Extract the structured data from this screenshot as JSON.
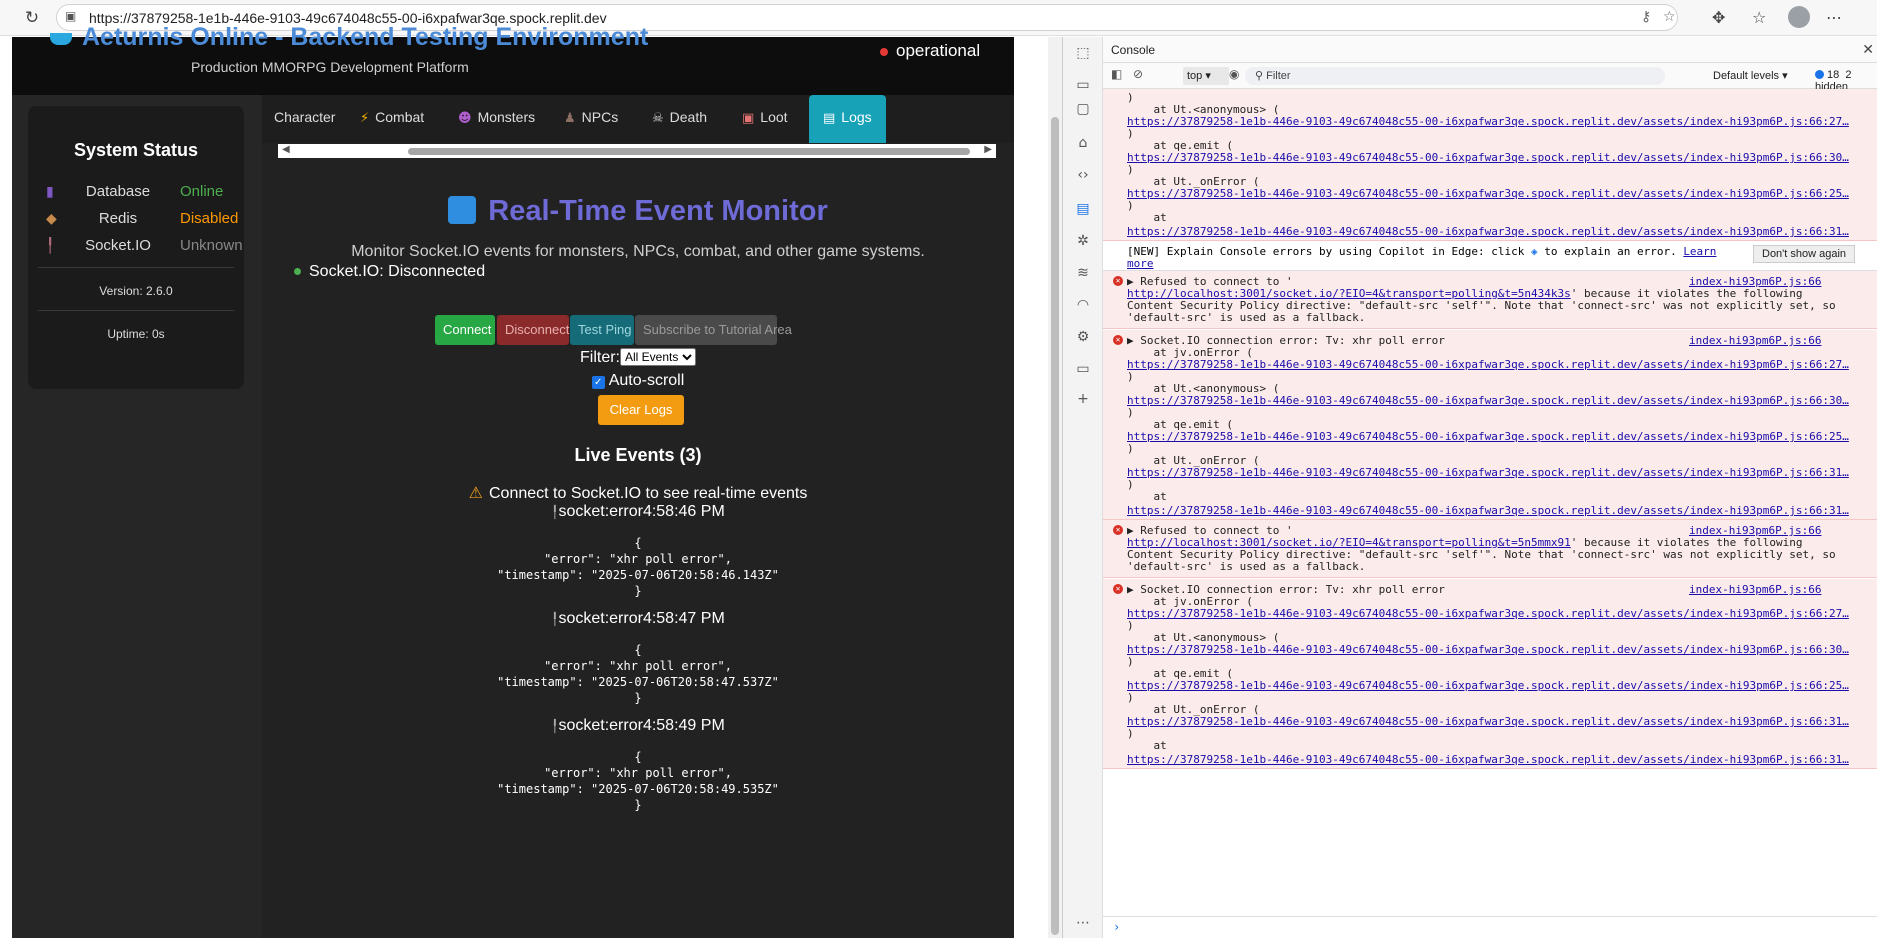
{
  "browser": {
    "url": "https://37879258-1e1b-446e-9103-49c674048c55-00-i6xpafwar3qe.spock.replit.dev"
  },
  "app": {
    "title": "Aeturnis Online - Backend Testing Environment",
    "subtitle": "Production MMORPG Development Platform",
    "status": "operational"
  },
  "system_status": {
    "heading": "System Status",
    "rows": [
      {
        "name": "Database",
        "value": "Online",
        "color": "#4caf50"
      },
      {
        "name": "Redis",
        "value": "Disabled",
        "color": "#ff9800"
      },
      {
        "name": "Socket.IO",
        "value": "Unknown",
        "color": "#888888"
      }
    ],
    "version": "Version: 2.6.0",
    "uptime": "Uptime: 0s"
  },
  "tabs": [
    "Character",
    "Combat",
    "Monsters",
    "NPCs",
    "Death",
    "Loot",
    "Logs"
  ],
  "monitor": {
    "title": "Real-Time Event Monitor",
    "description": "Monitor Socket.IO events for monsters, NPCs, combat, and other game systems.",
    "connection": "Socket.IO: Disconnected",
    "buttons": {
      "connect": "Connect",
      "disconnect": "Disconnect",
      "ping": "Test Ping",
      "subscribe": "Subscribe to Tutorial Area",
      "clear": "Clear Logs"
    },
    "filter_label": "Filter:",
    "filter_value": "All Events",
    "autoscroll": "Auto-scroll",
    "live_heading": "Live Events (3)",
    "warning": "Connect to Socket.IO to see real-time events",
    "events": [
      {
        "type": "socket:error",
        "time": "4:58:46 PM",
        "lines": [
          "{",
          "\"error\": \"xhr poll error\",",
          "\"timestamp\": \"2025-07-06T20:58:46.143Z\"",
          "}"
        ]
      },
      {
        "type": "socket:error",
        "time": "4:58:47 PM",
        "lines": [
          "{",
          "\"error\": \"xhr poll error\",",
          "\"timestamp\": \"2025-07-06T20:58:47.537Z\"",
          "}"
        ]
      },
      {
        "type": "socket:error",
        "time": "4:58:49 PM",
        "lines": [
          "{",
          "\"error\": \"xhr poll error\",",
          "\"timestamp\": \"2025-07-06T20:58:49.535Z\"",
          "}"
        ]
      }
    ]
  },
  "devtools": {
    "panel": "Console",
    "context": "top",
    "filter_placeholder": "Filter",
    "levels": "Default levels",
    "issues": "18",
    "hidden": "2 hidden",
    "stack_top": [
      ")",
      "    at Ut.<anonymous> (",
      "https://37879258-1e1b-446e-9103-49c674048c55-00-i6xpafwar3qe.spock.replit.dev/assets/index-hi93pm6P.js:66:27…",
      ")",
      "    at qe.emit (",
      "https://37879258-1e1b-446e-9103-49c674048c55-00-i6xpafwar3qe.spock.replit.dev/assets/index-hi93pm6P.js:66:30…",
      ")",
      "    at Ut._onError (",
      "https://37879258-1e1b-446e-9103-49c674048c55-00-i6xpafwar3qe.spock.replit.dev/assets/index-hi93pm6P.js:66:25…",
      ")",
      "    at",
      "https://37879258-1e1b-446e-9103-49c674048c55-00-i6xpafwar3qe.spock.replit.dev/assets/index-hi93pm6P.js:66:31…"
    ],
    "tip": "[NEW] Explain Console errors by using Copilot in Edge: click",
    "tip_tail": "to explain an error.",
    "tip_learn": "Learn",
    "tip_more": "more",
    "dont_show": "Don't show again",
    "refused1": {
      "src": "index-hi93pm6P.js:66",
      "l1": "▶ Refused to connect to '",
      "l2": "http://localhost:3001/socket.io/?EIO=4&transport=polling&t=5n434k3s",
      "l2b": "' because it violates the following",
      "l3": "Content Security Policy directive: \"default-src 'self'\". Note that 'connect-src' was not explicitly set, so",
      "l4": "'default-src' is used as a fallback."
    },
    "sioerr1": {
      "src": "index-hi93pm6P.js:66",
      "head": "▶ Socket.IO connection error: Tv: xhr poll error",
      "lines": [
        "    at jv.onError (",
        "https://37879258-1e1b-446e-9103-49c674048c55-00-i6xpafwar3qe.spock.replit.dev/assets/index-hi93pm6P.js:66:27…",
        ")",
        "    at Ut.<anonymous> (",
        "https://37879258-1e1b-446e-9103-49c674048c55-00-i6xpafwar3qe.spock.replit.dev/assets/index-hi93pm6P.js:66:30…",
        ")",
        "    at qe.emit (",
        "https://37879258-1e1b-446e-9103-49c674048c55-00-i6xpafwar3qe.spock.replit.dev/assets/index-hi93pm6P.js:66:25…",
        ")",
        "    at Ut._onError (",
        "https://37879258-1e1b-446e-9103-49c674048c55-00-i6xpafwar3qe.spock.replit.dev/assets/index-hi93pm6P.js:66:31…",
        ")",
        "    at",
        "https://37879258-1e1b-446e-9103-49c674048c55-00-i6xpafwar3qe.spock.replit.dev/assets/index-hi93pm6P.js:66:31…"
      ]
    },
    "refused2": {
      "src": "index-hi93pm6P.js:66",
      "l1": "▶ Refused to connect to '",
      "l2": "http://localhost:3001/socket.io/?EIO=4&transport=polling&t=5n5mmx91",
      "l2b": "' because it violates the following",
      "l3": "Content Security Policy directive: \"default-src 'self'\". Note that 'connect-src' was not explicitly set, so",
      "l4": "'default-src' is used as a fallback."
    },
    "sioerr2": {
      "src": "index-hi93pm6P.js:66",
      "head": "▶ Socket.IO connection error: Tv: xhr poll error",
      "lines": [
        "    at jv.onError (",
        "https://37879258-1e1b-446e-9103-49c674048c55-00-i6xpafwar3qe.spock.replit.dev/assets/index-hi93pm6P.js:66:27…",
        ")",
        "    at Ut.<anonymous> (",
        "https://37879258-1e1b-446e-9103-49c674048c55-00-i6xpafwar3qe.spock.replit.dev/assets/index-hi93pm6P.js:66:30…",
        ")",
        "    at qe.emit (",
        "https://37879258-1e1b-446e-9103-49c674048c55-00-i6xpafwar3qe.spock.replit.dev/assets/index-hi93pm6P.js:66:25…",
        ")",
        "    at Ut._onError (",
        "https://37879258-1e1b-446e-9103-49c674048c55-00-i6xpafwar3qe.spock.replit.dev/assets/index-hi93pm6P.js:66:31…",
        ")",
        "    at",
        "https://37879258-1e1b-446e-9103-49c674048c55-00-i6xpafwar3qe.spock.replit.dev/assets/index-hi93pm6P.js:66:31…"
      ]
    }
  }
}
